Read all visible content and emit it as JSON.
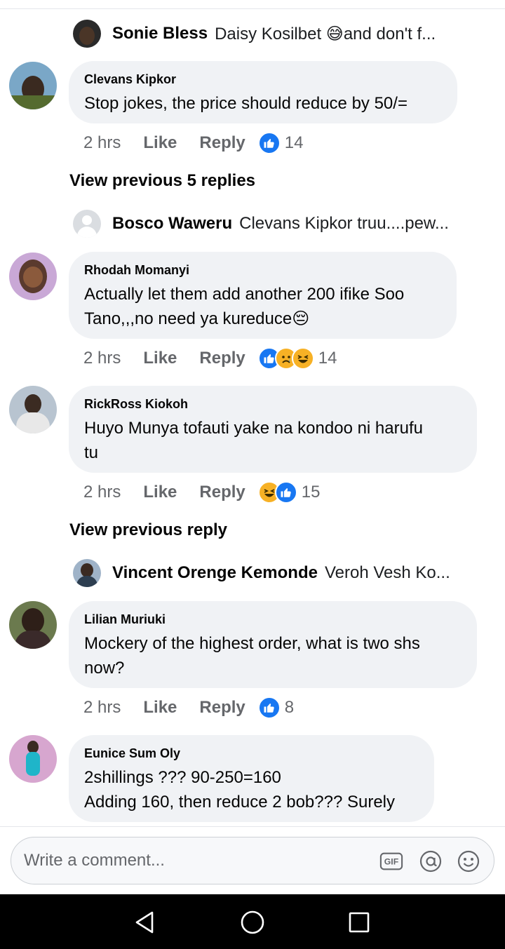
{
  "thread": {
    "replies_preview_1": {
      "name": "Sonie Bless",
      "text": "Daisy Kosilbet 😅and don't f..."
    },
    "comments": [
      {
        "author": "Clevans Kipkor",
        "text": "Stop jokes, the price should reduce by 50/=",
        "time": "2 hrs",
        "like_label": "Like",
        "reply_label": "Reply",
        "reaction_count": "14"
      },
      {
        "author": "Rhodah Momanyi",
        "text": "Actually let them add another 200 ifike Soo\nTano,,,no need ya kureduce😔",
        "time": "2 hrs",
        "like_label": "Like",
        "reply_label": "Reply",
        "reaction_count": "14"
      },
      {
        "author": "RickRoss Kiokoh",
        "text": "Huyo Munya tofauti yake na kondoo ni harufu\ntu",
        "time": "2 hrs",
        "like_label": "Like",
        "reply_label": "Reply",
        "reaction_count": "15"
      },
      {
        "author": "Lilian Muriuki",
        "text": "Mockery of the highest order, what is two shs\nnow?",
        "time": "2 hrs",
        "like_label": "Like",
        "reply_label": "Reply",
        "reaction_count": "8"
      },
      {
        "author": "Eunice Sum Oly",
        "text": "2shillings ??? 90-250=160\nAdding 160, then reduce 2 bob??? Surely"
      }
    ],
    "view_previous_1": "View previous 5 replies",
    "replies_preview_2": {
      "name": "Bosco Waweru",
      "text": "Clevans Kipkor truu....pew..."
    },
    "view_previous_2": "View previous reply",
    "replies_preview_3": {
      "name": "Vincent Orenge Kemonde",
      "text": "Veroh Vesh Ko..."
    }
  },
  "composer": {
    "placeholder": "Write a comment...",
    "gif_label": "GIF",
    "icons": [
      "gif-icon",
      "at-mention-icon",
      "emoji-icon"
    ]
  },
  "nav": {
    "icons": [
      "back-triangle-icon",
      "home-circle-icon",
      "recents-square-icon"
    ]
  },
  "colors": {
    "like_blue": "#1877f2",
    "bubble_gray": "#f0f2f5",
    "meta_gray": "#65676b"
  }
}
